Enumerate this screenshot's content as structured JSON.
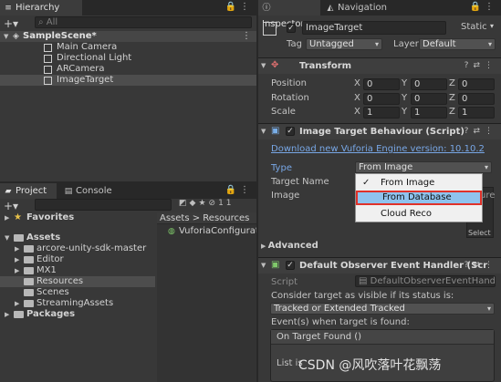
{
  "hierarchy": {
    "tab": "Hierarchy",
    "search_placeholder": "All",
    "scene": "SampleScene*",
    "items": [
      "Main Camera",
      "Directional Light",
      "ARCamera",
      "ImageTarget"
    ]
  },
  "project": {
    "tabs": [
      "Project",
      "Console"
    ],
    "hidden_count": "11",
    "favorites": "Favorites",
    "assets": "Assets",
    "folders": [
      "arcore-unity-sdk-master",
      "Editor",
      "MX1",
      "Resources",
      "Scenes",
      "StreamingAssets"
    ],
    "packages": "Packages",
    "breadcrumb": [
      "Assets",
      "Resources"
    ],
    "files": [
      "VuforiaConfiguration"
    ]
  },
  "inspector": {
    "tabs": [
      "Inspector",
      "Navigation"
    ],
    "object_name": "ImageTarget",
    "static_label": "Static",
    "tag_label": "Tag",
    "tag_value": "Untagged",
    "layer_label": "Layer",
    "layer_value": "Default",
    "transform": {
      "title": "Transform",
      "rows": [
        {
          "label": "Position",
          "x": "0",
          "y": "0",
          "z": "0"
        },
        {
          "label": "Rotation",
          "x": "0",
          "y": "0",
          "z": "0"
        },
        {
          "label": "Scale",
          "x": "1",
          "y": "1",
          "z": "1"
        }
      ],
      "axis": [
        "X",
        "Y",
        "Z"
      ]
    },
    "image_target": {
      "title": "Image Target Behaviour (Script)",
      "download_link": "Download new Vuforia Engine version: 10.10.2",
      "type_label": "Type",
      "type_value": "From Image",
      "target_name_label": "Target Name",
      "image_label": "Image",
      "ure_fragment": "ure",
      "select_label": "Select",
      "dropdown_options": [
        "From Image",
        "From Database",
        "Cloud Reco"
      ],
      "selected_option": "From Image",
      "highlighted_option": "From Database"
    },
    "advanced": "Advanced",
    "observer": {
      "title": "Default Observer Event Handler (Scr",
      "script_label": "Script",
      "script_value": "DefaultObserverEventHandle",
      "consider_text": "Consider target as visible if its status is:",
      "status_value": "Tracked or Extended Tracked",
      "event_text": "Event(s) when target is found:",
      "on_found": "On Target Found ()",
      "list_fragment": "List is"
    }
  },
  "watermark": "CSDN @风吹落叶花飘荡",
  "colors": {
    "link": "#78a7e6",
    "highlight_border": "#e0322a",
    "selected_row": "#2c5d87"
  }
}
